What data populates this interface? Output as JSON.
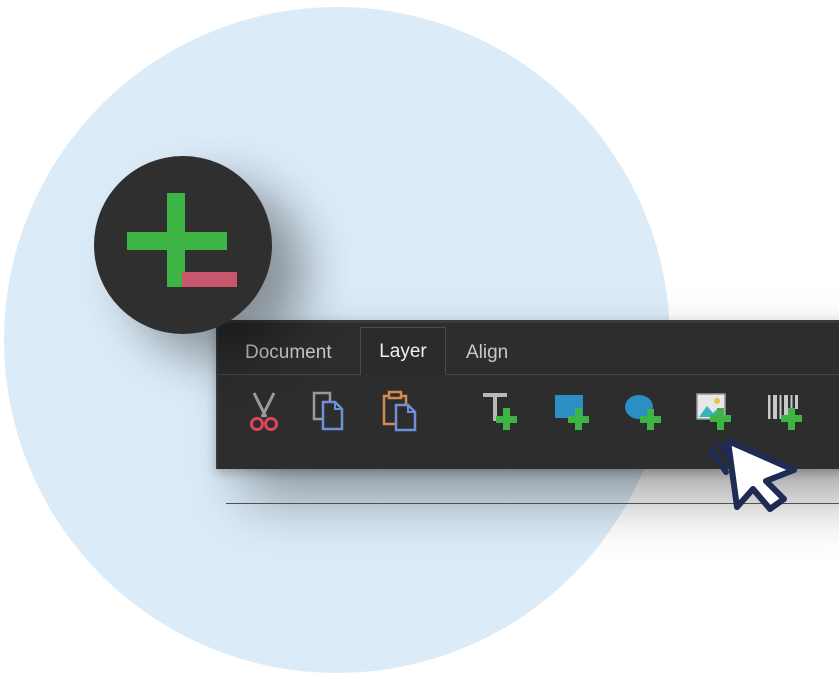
{
  "tabs": [
    {
      "label": "Document",
      "active": false
    },
    {
      "label": "Layer",
      "active": true
    },
    {
      "label": "Align",
      "active": false
    }
  ],
  "toolbar": {
    "tools": [
      {
        "icon": "cut-icon"
      },
      {
        "icon": "copy-icon"
      },
      {
        "icon": "paste-icon"
      },
      {
        "icon": "add-text-icon"
      },
      {
        "icon": "add-rectangle-icon"
      },
      {
        "icon": "add-ellipse-icon"
      },
      {
        "icon": "add-image-icon"
      },
      {
        "icon": "add-barcode-icon"
      }
    ]
  },
  "badge": {
    "icon": "plus-minus-icon"
  },
  "cursor": {
    "icon": "mouse-pointer-icon"
  },
  "colors": {
    "background_circle": "#dbebf8",
    "panel": "#2d2d2d",
    "accent_green": "#3db443",
    "accent_red": "#c8566c",
    "icon_blue": "#2b8fc4",
    "cursor_navy": "#1f2a55"
  }
}
